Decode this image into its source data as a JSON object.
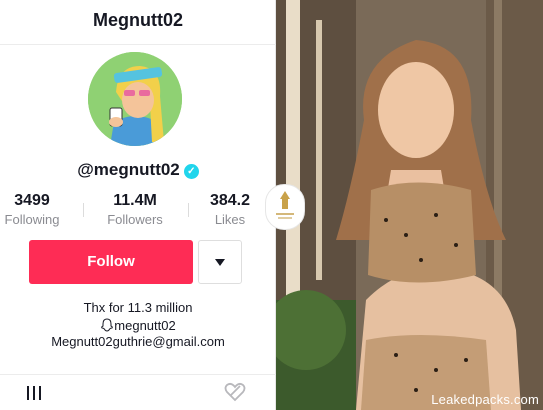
{
  "profile": {
    "title": "Megnutt02",
    "handle": "@megnutt02",
    "verified_icon": "verified-check-icon",
    "stats": [
      {
        "value": "3499",
        "label": "Following"
      },
      {
        "value": "11.4M",
        "label": "Followers"
      },
      {
        "value": "384.2",
        "label": "Likes"
      }
    ],
    "follow_label": "Follow",
    "dropdown_icon": "caret-down-icon",
    "bio": {
      "line1": "Thx for 11.3 million",
      "line2": "megnutt02",
      "line2_icon": "snapchat-ghost-icon",
      "line3": "Megnutt02guthrie@gmail.com"
    },
    "tabs": {
      "videos_icon": "grid-icon",
      "liked_icon": "liked-heart-icon"
    }
  },
  "photo": {
    "watermark_text": "Leakedpacks.com",
    "badge_icon": "logo-badge-icon"
  },
  "colors": {
    "follow_button": "#fe2c55",
    "verified": "#20d5ec",
    "text_primary": "#161823",
    "text_secondary": "#8a8b91"
  }
}
